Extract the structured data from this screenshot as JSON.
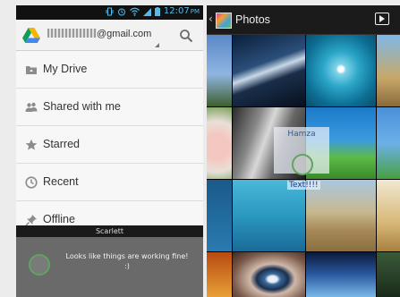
{
  "status_bar": {
    "time": "12:07",
    "ampm": "PM"
  },
  "drive": {
    "account_visible_suffix": "@gmail.com",
    "menu": [
      {
        "label": "My Drive",
        "icon": "folder-icon"
      },
      {
        "label": "Shared with me",
        "icon": "people-icon"
      },
      {
        "label": "Starred",
        "icon": "star-icon"
      },
      {
        "label": "Recent",
        "icon": "clock-icon"
      },
      {
        "label": "Offline",
        "icon": "pin-icon"
      }
    ],
    "toast": {
      "title": "Scarlett",
      "message": "Looks like things are working fine!\n:)"
    }
  },
  "photos": {
    "title": "Photos",
    "overlay_name": "Hamza",
    "overlay_text": "Text!!!!"
  },
  "colors": {
    "accent_blue": "#56b8e6",
    "toast_bg": "#6a6a6a",
    "ring_green": "#5fa45f"
  }
}
